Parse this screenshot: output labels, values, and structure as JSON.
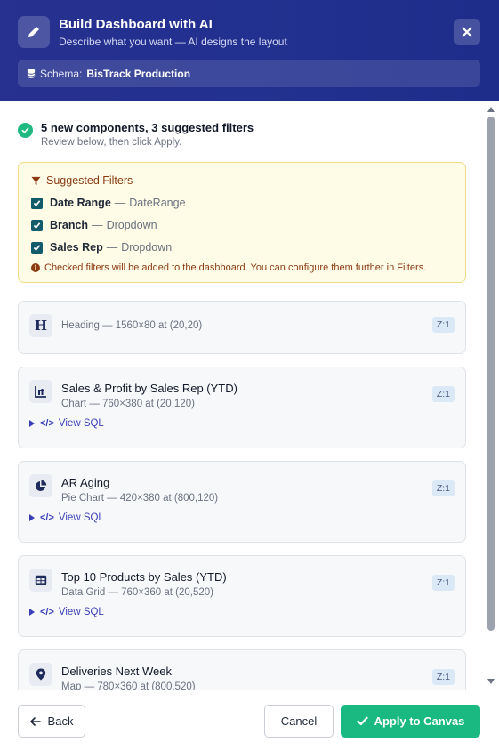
{
  "header": {
    "title": "Build Dashboard with AI",
    "subtitle": "Describe what you want — AI designs the layout",
    "schema_label": "Schema:",
    "schema_value": "BisTrack Production",
    "icons": {
      "main": "pencil-icon",
      "close": "close-icon",
      "schema": "database-icon"
    }
  },
  "summary": {
    "title": "5 new components, 3 suggested filters",
    "subtitle": "Review below, then click Apply."
  },
  "filters": {
    "title": "Suggested Filters",
    "items": [
      {
        "name": "Date Range",
        "sep": "—",
        "type": "DateRange",
        "checked": true
      },
      {
        "name": "Branch",
        "sep": "—",
        "type": "Dropdown",
        "checked": true
      },
      {
        "name": "Sales Rep",
        "sep": "—",
        "type": "Dropdown",
        "checked": true
      }
    ],
    "note": "Checked filters will be added to the dashboard. You can configure them further in Filters."
  },
  "components": [
    {
      "name": "",
      "meta": "Heading — 1560×80 at (20,20)",
      "z": "Z:1",
      "icon": "heading-icon",
      "sql": ""
    },
    {
      "name": "Sales & Profit by Sales Rep (YTD)",
      "meta": "Chart — 760×380 at (20,120)",
      "z": "Z:1",
      "icon": "bar-chart-icon",
      "sql": "View SQL"
    },
    {
      "name": "AR Aging",
      "meta": "Pie Chart — 420×380 at (800,120)",
      "z": "Z:1",
      "icon": "pie-chart-icon",
      "sql": "View SQL"
    },
    {
      "name": "Top 10 Products by Sales (YTD)",
      "meta": "Data Grid — 760×360 at (20,520)",
      "z": "Z:1",
      "icon": "table-icon",
      "sql": "View SQL"
    },
    {
      "name": "Deliveries Next Week",
      "meta": "Map — 780×360 at (800,520)",
      "z": "Z:1",
      "icon": "map-pin-icon",
      "sql": ""
    }
  ],
  "footer": {
    "back": "Back",
    "cancel": "Cancel",
    "apply": "Apply to Canvas"
  },
  "colors": {
    "header_bg": "#22308f",
    "accent_green": "#1bb982",
    "link": "#3b3fb6",
    "filter_bg": "#fefbe6",
    "filter_text": "#8a3b12"
  }
}
